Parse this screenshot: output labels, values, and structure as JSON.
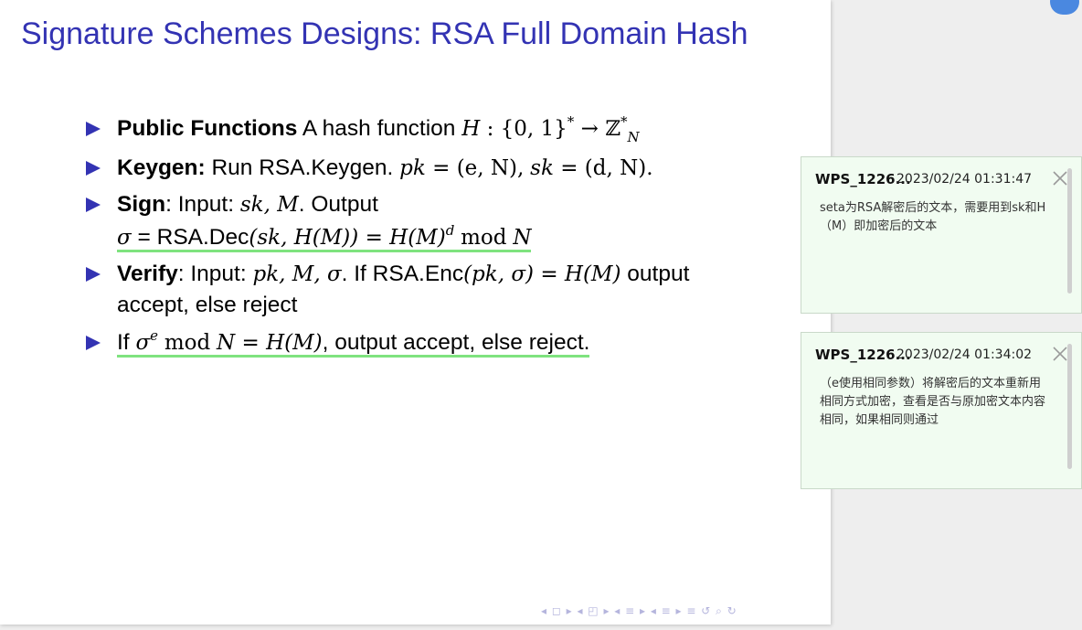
{
  "slide": {
    "title": "Signature Schemes Designs: RSA Full Domain Hash",
    "bullets": {
      "public_functions": {
        "label": "Public Functions",
        "text": "A hash function",
        "math_h": "H",
        "math_colon": " : {0, 1}",
        "math_star": "*",
        "math_arrow": " → ℤ",
        "math_zsup": "*",
        "math_zsub": "N"
      },
      "keygen": {
        "label": "Keygen:",
        "text": "Run RSA.Keygen.",
        "math_pk": "pk",
        "math_pk_val": " = (e, N),",
        "math_sk": "sk",
        "math_sk_val": " = (d, N)."
      },
      "sign": {
        "label": "Sign",
        "text": ": Input:",
        "math_in": "sk, M",
        "text2": ". Output",
        "line2_sigma": "σ",
        "line2_eq": " = RSA.Dec",
        "line2_args": "(sk, H(M)) = H(M)",
        "line2_d": "d",
        "line2_mod": "mod",
        "line2_n": "N"
      },
      "verify": {
        "label": "Verify",
        "text": ": Input:",
        "math_in": "pk, M, σ",
        "text2": ". If RSA.Enc",
        "math_args": "(pk, σ) = H(M)",
        "text3": "output",
        "line2": "accept, else reject"
      },
      "final": {
        "text_if": "If",
        "sigma": "σ",
        "sup_e": "e",
        "mod": "mod",
        "rest": "N = H(M)",
        "text_end": ", output accept, else reject."
      }
    },
    "nav_symbols": "◂ ◻ ▸ ◂ ◰ ▸ ◂ ≡ ▸ ◂ ≡ ▸  ≡  ↺ ⌕ ↻"
  },
  "comments": [
    {
      "author": "WPS_1226...",
      "time": "2023/02/24 01:31:47",
      "body": "seta为RSA解密后的文本，需要用到sk和H（M）即加密后的文本"
    },
    {
      "author": "WPS_1226...",
      "time": "2023/02/24 01:34:02",
      "body": "（e使用相同参数）将解密后的文本重新用相同方式加密，查看是否与原加密文本内容相同，如果相同则通过"
    }
  ],
  "colors": {
    "title": "#3333b3",
    "bullet_triangle": "#3333b3",
    "highlight_underline": "#7fe37f",
    "comment_bg": "#f1fcf1"
  }
}
